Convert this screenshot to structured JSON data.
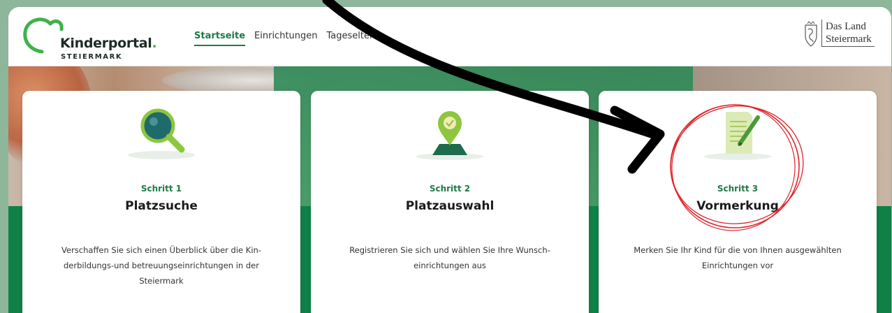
{
  "header": {
    "logo": {
      "name": "Kinderportal",
      "dot": ".",
      "sub": "STEIERMARK"
    },
    "nav": [
      {
        "label": "Startseite",
        "active": true
      },
      {
        "label": "Einrichtungen",
        "active": false
      },
      {
        "label": "Tageseltern",
        "active": false
      }
    ],
    "land_logo": {
      "line1": "Das Land",
      "line2": "Steiermark"
    }
  },
  "cards": [
    {
      "icon": "magnifier-icon",
      "step": "Schritt 1",
      "title": "Platzsuche",
      "desc_lines": [
        "Verschaffen Sie sich einen Überblick über die Kin-",
        "derbildungs-und betreuungseinrichtungen in der",
        "Steiermark"
      ]
    },
    {
      "icon": "map-pin-check-icon",
      "step": "Schritt 2",
      "title": "Platzauswahl",
      "desc_lines": [
        "Registrieren Sie sich und wählen Sie Ihre Wunsch-",
        "einrichtungen aus"
      ]
    },
    {
      "icon": "document-pencil-icon",
      "step": "Schritt 3",
      "title": "Vormerkung",
      "desc_lines": [
        "Merken Sie Ihr Kind für die von Ihnen ausgewählten",
        "Einrichtungen vor"
      ]
    }
  ],
  "colors": {
    "brand_green": "#1e7a45",
    "logo_green": "#3fb24a",
    "floor_green": "#0f8147",
    "outer_bg": "#8db69a",
    "annotation_red": "#e0242b"
  }
}
